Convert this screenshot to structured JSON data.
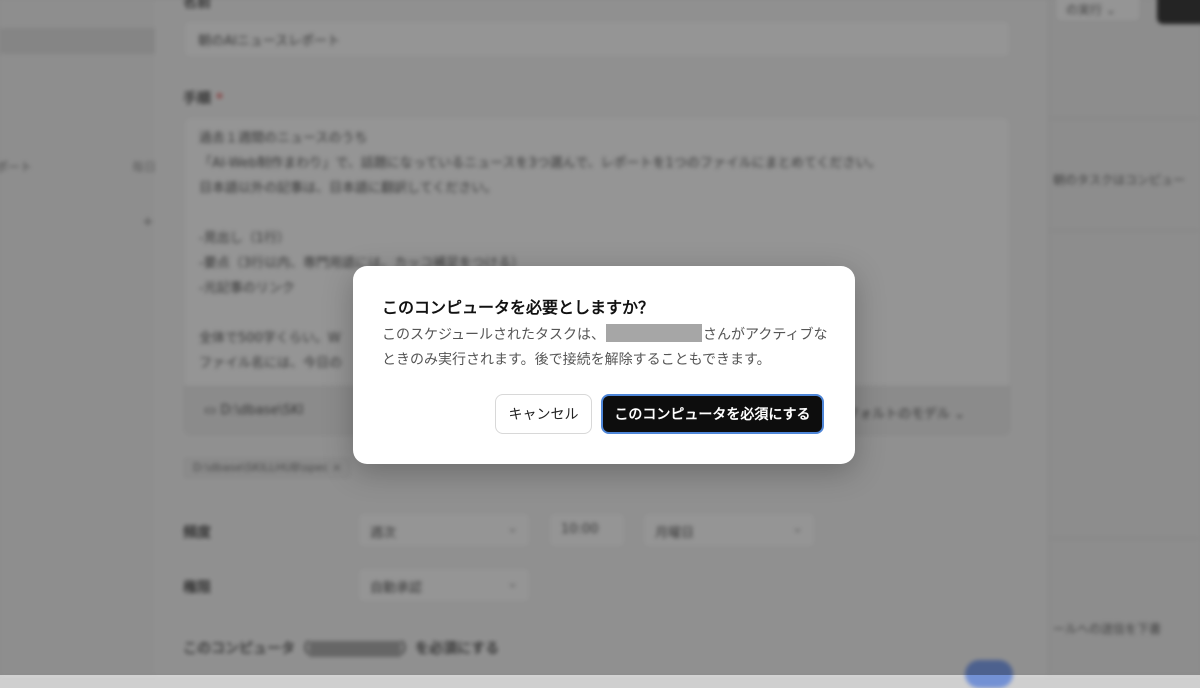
{
  "sidebar": {
    "report_text": "ポート",
    "misc_text": "毎日",
    "plus_glyph": "+"
  },
  "form": {
    "name_label": "名前",
    "name_value": "朝のAIニュースレポート",
    "steps_label": "手順",
    "steps_required_mark": "*",
    "steps_text": "過去１週間のニュースのうち\n「AI-Web制作まわり」で、話題になっているニュースを3つ選んで、レポートを1つのファイルにまとめてください。\n日本語以外の記事は、日本語に翻訳してください。\n\n-見出し（1行）\n-要点（3行以内、専門用語には、カッコ補足をつける）\n-元記事のリンク\n\n全体で500字くらい。W\nファイル名には、今日の",
    "folder_icon": "folder-icon",
    "folder_text": "D:\\dbase\\SKI",
    "model_text": "フォルトのモデル",
    "chip_text": "D:\\dbase\\SKILLHUB\\spec ×",
    "frequency_label": "頻度",
    "frequency_value": "週次",
    "time_value": "10:00",
    "weekday_value": "月曜日",
    "permission_label": "権限",
    "permission_value": "自動承認",
    "require_prefix": "このコンピュータ（",
    "require_suffix": "）を必須にする",
    "chevron": "⌄"
  },
  "right_panel": {
    "run_button_label": "の実行 ⌄",
    "task_text": "朝のタスクはコンピュー",
    "footer_text": "ールへの送信を下書"
  },
  "dialog": {
    "title": "このコンピュータを必要としますか？",
    "body_before": "このスケジュールされたタスクは、",
    "body_after": "さんがアクティブなときのみ実行されます。後で接続を解除することもできます。",
    "cancel_label": "キャンセル",
    "confirm_label": "このコンピュータを必須にする"
  }
}
